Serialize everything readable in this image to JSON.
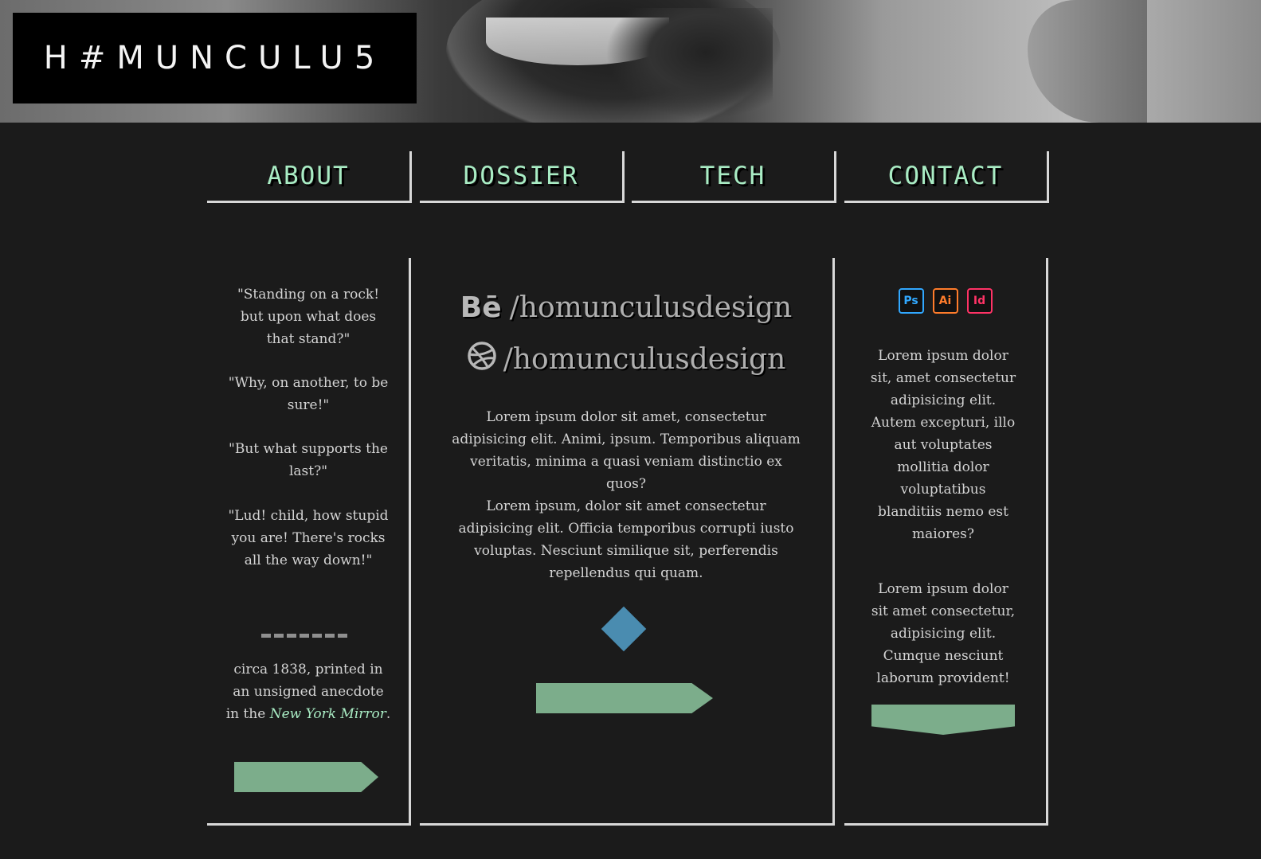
{
  "header": {
    "logo_text": "H#MUNCULU5"
  },
  "nav": {
    "tabs": [
      {
        "label": "ABOUT"
      },
      {
        "label": "DOSSIER"
      },
      {
        "label": "TECH"
      },
      {
        "label": "CONTACT"
      }
    ]
  },
  "left_column": {
    "quotes": [
      "\"Standing on a rock! but upon what does that stand?\"",
      "\"Why, on another, to be sure!\"",
      "\"But what supports the last?\"",
      "\"Lud! child, how stupid you are! There's rocks all the way down!\""
    ],
    "citation_prefix": "circa 1838, printed in an unsigned anecdote in the ",
    "citation_source": "New York Mirror",
    "citation_suffix": "."
  },
  "middle_column": {
    "behance_logo": "Bē",
    "behance_handle": "/homunculusdesign",
    "dribbble_handle": "/homunculusdesign",
    "paragraph1": "Lorem ipsum dolor sit amet, consectetur adipisicing elit. Animi, ipsum. Temporibus aliquam veritatis, minima a quasi veniam distinctio ex quos?",
    "paragraph2": "Lorem ipsum, dolor sit amet consectetur adipisicing elit. Officia temporibus corrupti iusto voluptas. Nesciunt similique sit, perferendis repellendus qui quam."
  },
  "right_column": {
    "app_icons": [
      {
        "label": "Ps",
        "icon": "photoshop-icon",
        "color": "#31a8ff"
      },
      {
        "label": "Ai",
        "icon": "illustrator-icon",
        "color": "#ff7c2b"
      },
      {
        "label": "Id",
        "icon": "indesign-icon",
        "color": "#ff3366"
      }
    ],
    "paragraph1": "Lorem ipsum dolor sit, amet consectetur adipisicing elit. Autem excepturi, illo aut voluptates mollitia dolor voluptatibus blanditiis nemo est maiores?",
    "paragraph2": "Lorem ipsum dolor sit amet consectetur, adipisicing elit. Cumque nesciunt laborum provident!"
  },
  "colors": {
    "background": "#1b1b1b",
    "accent_green": "#a9ecc4",
    "button_green": "#7cad8b",
    "diamond_blue": "#4a8cb0",
    "border": "#d8d8d8"
  }
}
